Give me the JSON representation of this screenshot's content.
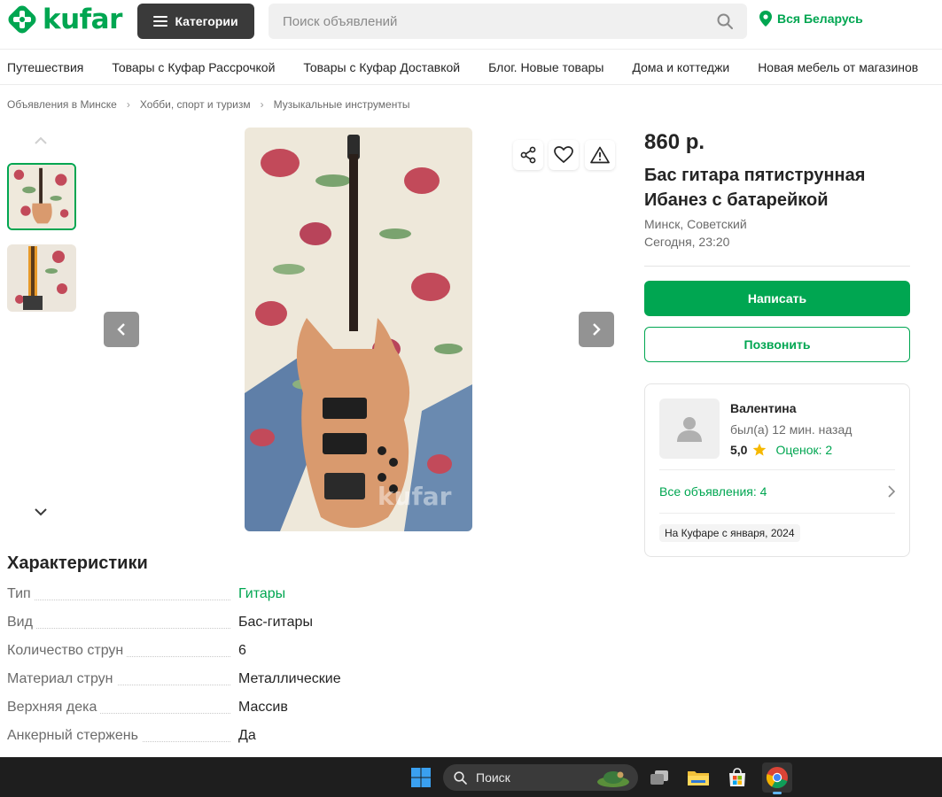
{
  "header": {
    "logo_text": "kufar",
    "categories_label": "Категории",
    "search_placeholder": "Поиск объявлений",
    "region_label": "Вся Беларусь"
  },
  "topnav": [
    "Путешествия",
    "Товары с Куфар Рассрочкой",
    "Товары с Куфар Доставкой",
    "Блог. Новые товары",
    "Дома и коттеджи",
    "Новая мебель от магазинов"
  ],
  "breadcrumbs": [
    "Объявления в Минске",
    "Хобби, спорт и туризм",
    "Музыкальные инструменты"
  ],
  "listing": {
    "price": "860 р.",
    "title": "Бас гитара пятиструнная Ибанез с батарейкой",
    "location": "Минск, Советский",
    "posted": "Сегодня, 23:20",
    "write_label": "Написать",
    "call_label": "Позвонить",
    "watermark": "kufar"
  },
  "seller": {
    "name": "Валентина",
    "last_seen": "был(а) 12 мин. назад",
    "rating": "5,0",
    "reviews": "Оценок: 2",
    "all_ads": "Все объявления: 4",
    "since": "На Куфаре с января, 2024"
  },
  "characteristics": {
    "title": "Характеристики",
    "rows": [
      {
        "label": "Тип",
        "value": "Гитары"
      },
      {
        "label": "Вид",
        "value": "Бас-гитары"
      },
      {
        "label": "Количество струн",
        "value": "6"
      },
      {
        "label": "Материал струн",
        "value": "Металлические"
      },
      {
        "label": "Верхняя дека",
        "value": "Массив"
      },
      {
        "label": "Анкерный стержень",
        "value": "Да"
      }
    ]
  },
  "taskbar": {
    "search_label": "Поиск"
  },
  "colors": {
    "brand": "#00a651",
    "dark_button": "#3a3a3a",
    "taskbar": "#1e1e1e"
  },
  "icons": [
    "kufar-logo-icon",
    "menu-icon",
    "search-icon",
    "location-pin-icon",
    "chevron-up-icon",
    "chevron-down-icon",
    "arrow-left-icon",
    "arrow-right-icon",
    "share-icon",
    "heart-icon",
    "warning-icon",
    "user-icon",
    "star-icon",
    "chevron-right-icon",
    "windows-start-icon",
    "file-explorer-icon",
    "store-icon",
    "chrome-icon"
  ]
}
